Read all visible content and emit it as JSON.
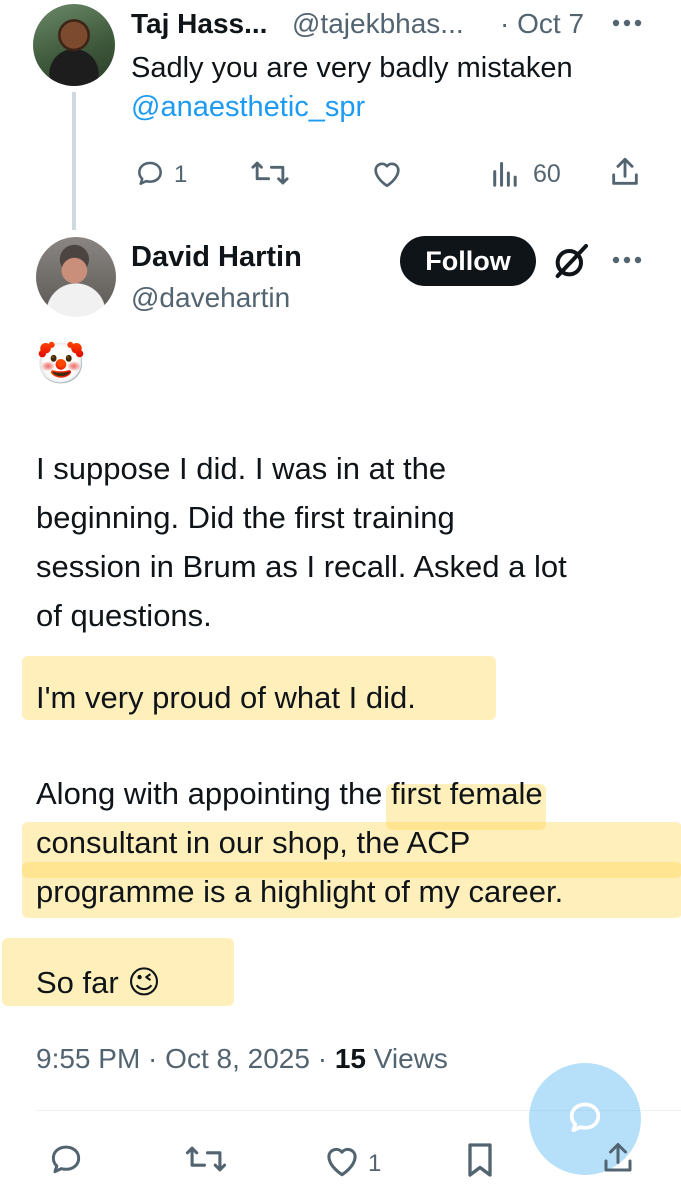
{
  "reply_parent": {
    "author_name": "Taj Hass...",
    "handle": "@tajekbhas...",
    "time": "· Oct 7",
    "text_line1": "Sadly you are very badly mistaken",
    "mention": "@anaesthetic_spr",
    "reply_count": "1",
    "views_count": "60"
  },
  "tweet": {
    "author_name": "David Hartin",
    "handle": "@davehartin",
    "follow_label": "Follow",
    "emoji_top": "🤡",
    "lines_p1": [
      "I suppose I did. I was in at the",
      "beginning. Did the first training",
      "session in Brum as I recall. Asked a lot",
      "of questions."
    ],
    "line_p2": "I'm very proud of what I did.",
    "lines_p3": [
      "Along with appointing the first female",
      "consultant in our shop, the ACP",
      "programme is a highlight of my career."
    ],
    "line_p4": "So far",
    "emoji_end": "😉",
    "timestamp": "9:55 PM · Oct 8, 2025 · ",
    "views_count": "15",
    "views_label": " Views",
    "like_count": "1"
  },
  "colors": {
    "accent": "#1d9bf0",
    "text": "#0f1419",
    "muted": "#536471",
    "highlight": "#ffd64d"
  },
  "icons": {
    "reply": "reply-icon",
    "retweet": "retweet-icon",
    "like": "heart-icon",
    "views": "views-icon",
    "share": "share-icon",
    "bookmark": "bookmark-icon",
    "grok": "grok-icon",
    "more": "more-icon",
    "compose": "compose-reply-icon"
  }
}
